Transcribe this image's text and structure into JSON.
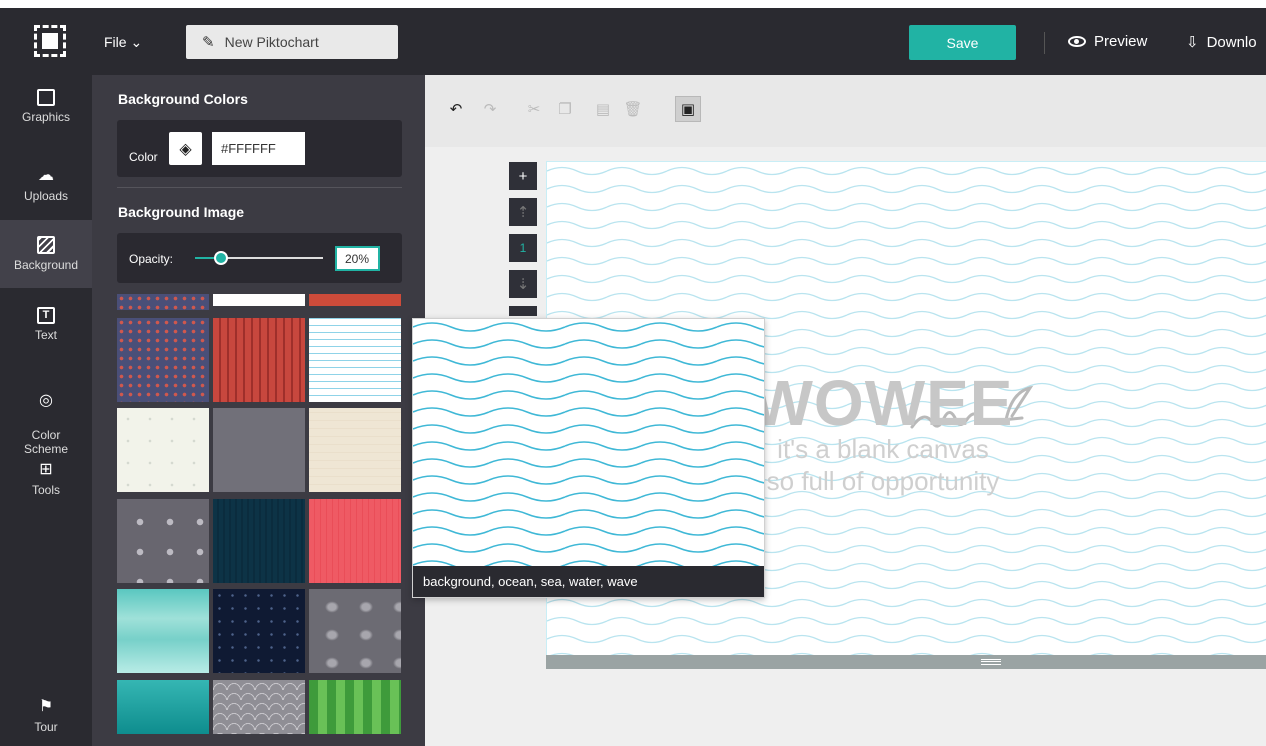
{
  "topbar": {
    "file_label": "File",
    "title": "New Piktochart",
    "save_label": "Save",
    "preview_label": "Preview",
    "download_label": "Downlo"
  },
  "sidebar": {
    "items": [
      {
        "label": "Graphics",
        "icon": "image-icon"
      },
      {
        "label": "Uploads",
        "icon": "cloud-upload-icon"
      },
      {
        "label": "Background",
        "icon": "hatch-icon"
      },
      {
        "label": "Text",
        "icon": "text-box-icon"
      },
      {
        "label": "Color\nScheme",
        "icon": "palette-icon"
      },
      {
        "label": "Tools",
        "icon": "toolbox-icon"
      },
      {
        "label": "Tour",
        "icon": "signpost-icon"
      }
    ],
    "active": "Background"
  },
  "panel": {
    "bg_colors_title": "Background Colors",
    "color_label": "Color",
    "color_value": "#FFFFFF",
    "bg_image_title": "Background Image",
    "opacity_label": "Opacity:",
    "opacity_value": "20%",
    "opacity_fraction": 0.2
  },
  "popup": {
    "caption": "background, ocean, sea, water, wave"
  },
  "canvas": {
    "headline": "WOWEE",
    "line1": "it's a blank canvas",
    "line2": "so full of opportunity",
    "page_number": "1"
  },
  "colors": {
    "accent": "#21b3a4",
    "dark_bg": "#2a2a30",
    "panel_bg": "#3c3b43"
  }
}
